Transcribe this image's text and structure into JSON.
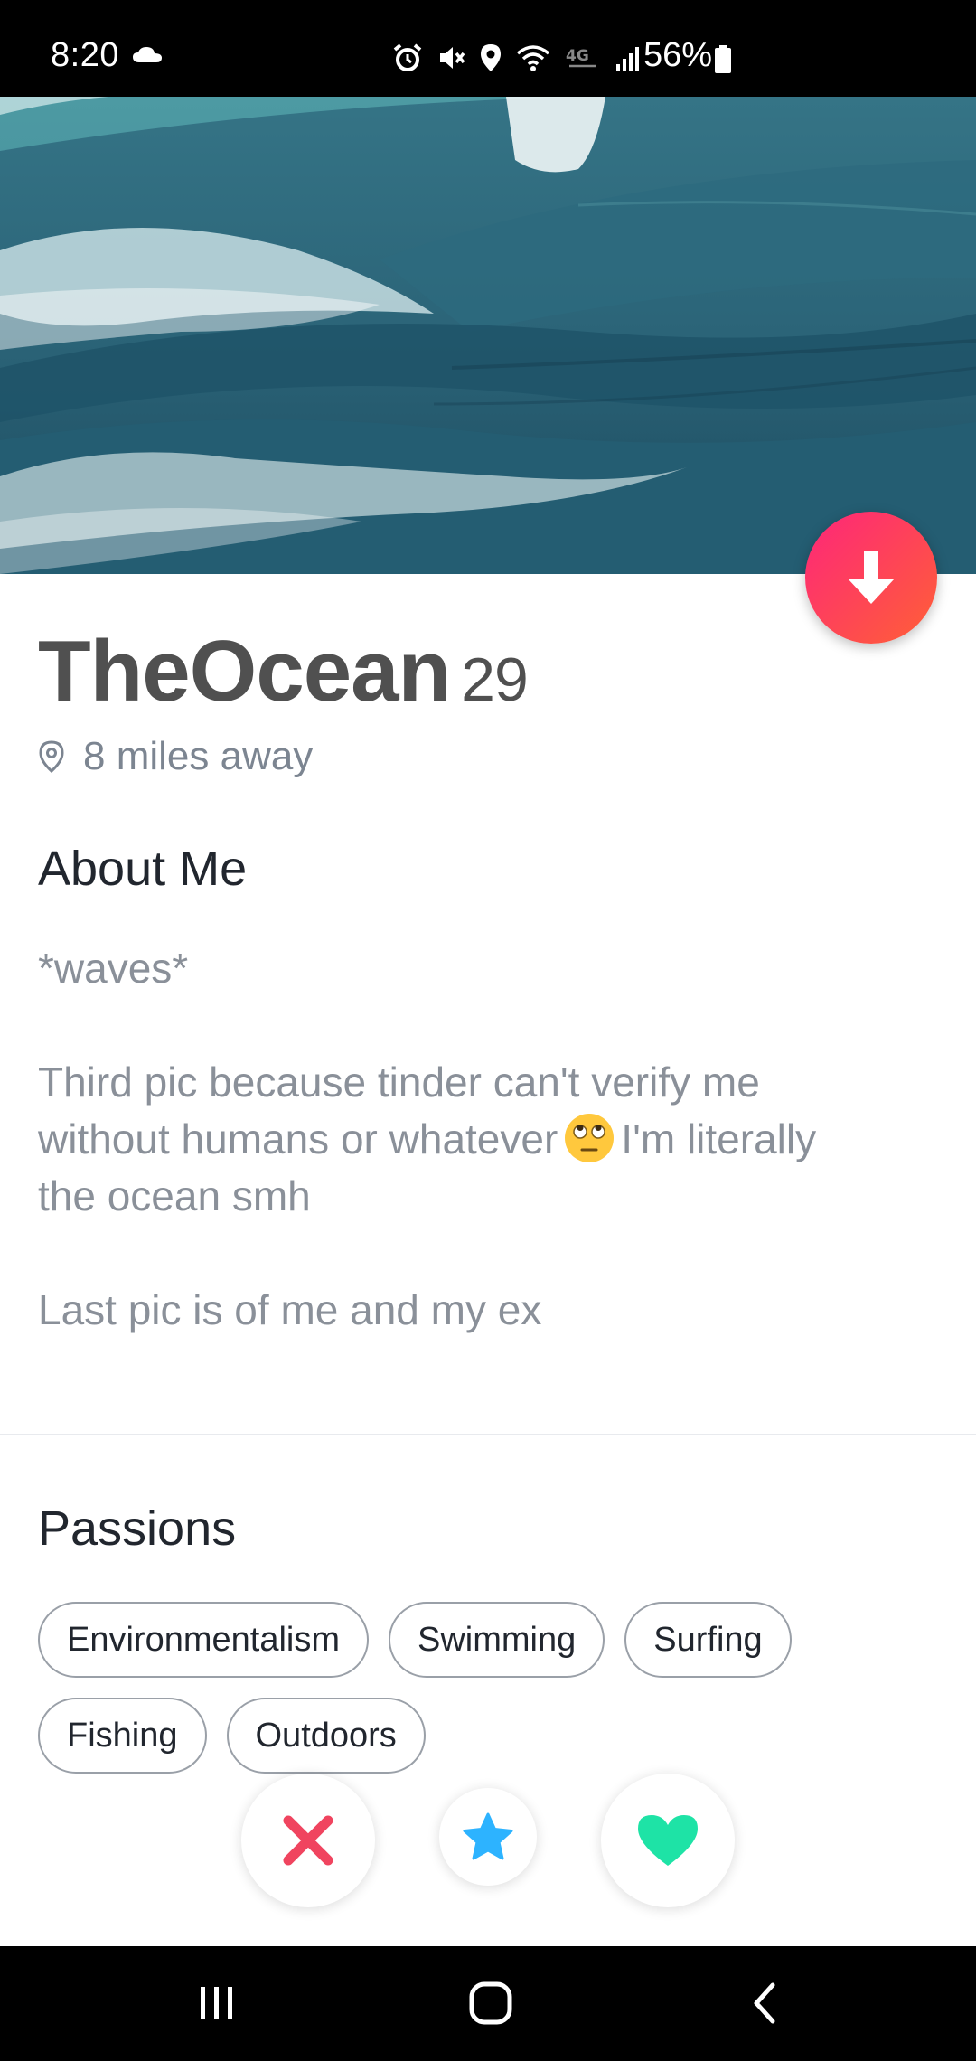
{
  "status_bar": {
    "time": "8:20",
    "network_label": "4G",
    "battery_percent": "56%",
    "icons": [
      "cloud-icon",
      "alarm-icon",
      "mute-icon",
      "location-icon",
      "wifi-icon",
      "data-icon",
      "signal-icon",
      "battery-icon"
    ]
  },
  "hero": {
    "image_description_icon": "ocean-wave-photo"
  },
  "profile": {
    "name": "TheOcean",
    "age": "29",
    "distance": "8 miles away"
  },
  "about": {
    "title": "About Me",
    "line1": "*waves*",
    "line2a": "Third pic because tinder can't verify me",
    "line2b_before": "without humans or whatever",
    "line2b_after": "I'm literally",
    "line2c": "the ocean smh",
    "line3": "Last pic is of me and my ex"
  },
  "passions": {
    "title": "Passions",
    "items": [
      "Environmentalism",
      "Swimming",
      "Surfing",
      "Fishing",
      "Outdoors"
    ]
  },
  "colors": {
    "accent_gradient_start": "#fd267a",
    "accent_gradient_end": "#ff6036",
    "nope": "#f0445f",
    "super_like": "#2db3ff",
    "like": "#1ee3a6"
  }
}
